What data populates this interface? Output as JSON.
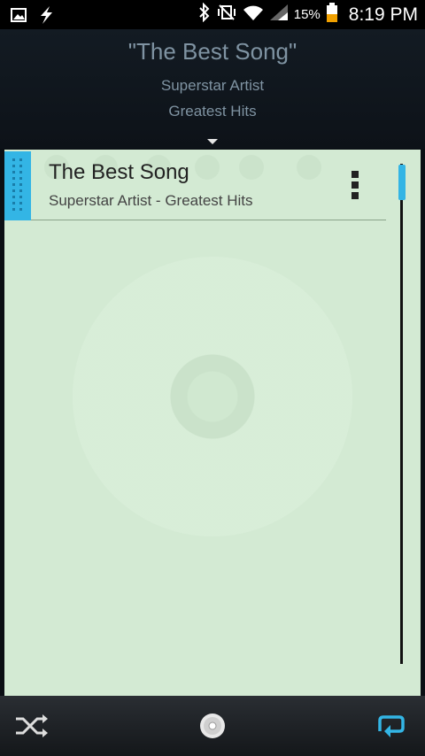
{
  "status_bar": {
    "battery_percent": "15%",
    "time": "8:19 PM"
  },
  "header": {
    "title": "\"The Best Song\"",
    "artist": "Superstar Artist",
    "album": "Greatest Hits"
  },
  "queue": {
    "items": [
      {
        "title": "The Best Song",
        "subtitle": "Superstar Artist - Greatest Hits"
      }
    ]
  },
  "colors": {
    "accent": "#33b5e5",
    "panel": "#d3ead3"
  },
  "controls": {
    "shuffle": "shuffle-icon",
    "album": "cd-icon",
    "repeat": "repeat-icon"
  }
}
